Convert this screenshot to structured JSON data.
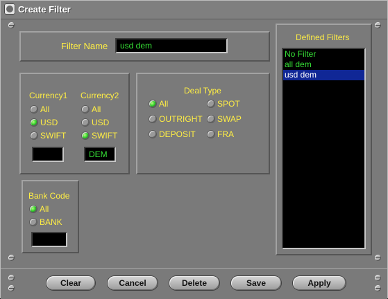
{
  "window": {
    "title": "Create Filter"
  },
  "filter_name": {
    "label": "Filter Name",
    "value": "usd dem"
  },
  "currency": {
    "col1_label": "Currency1",
    "col2_label": "Currency2",
    "col1_options": [
      "All",
      "USD",
      "SWIFT"
    ],
    "col2_options": [
      "All",
      "USD",
      "SWIFT"
    ],
    "col1_value": "",
    "col2_value": "DEM",
    "col1_selected": "USD",
    "col2_selected": "SWIFT"
  },
  "deal_type": {
    "label": "Deal Type",
    "options": [
      "All",
      "OUTRIGHT",
      "DEPOSIT",
      "SPOT",
      "SWAP",
      "FRA"
    ],
    "selected": "All"
  },
  "bank_code": {
    "label": "Bank Code",
    "options": [
      "All",
      "BANK"
    ],
    "selected": "All",
    "value": ""
  },
  "defined_filters": {
    "label": "Defined Filters",
    "items": [
      "No Filter",
      "all dem",
      "usd dem"
    ],
    "selected": "usd dem"
  },
  "buttons": {
    "clear": "Clear",
    "cancel": "Cancel",
    "delete": "Delete",
    "save": "Save",
    "apply": "Apply"
  },
  "colors": {
    "label_yellow": "#ffee44",
    "field_green": "#36e036",
    "selection_blue": "#102796",
    "window_gray": "#7a7a7a"
  },
  "icons": [
    "app-icon",
    "screw-icon",
    "radio-icon"
  ]
}
